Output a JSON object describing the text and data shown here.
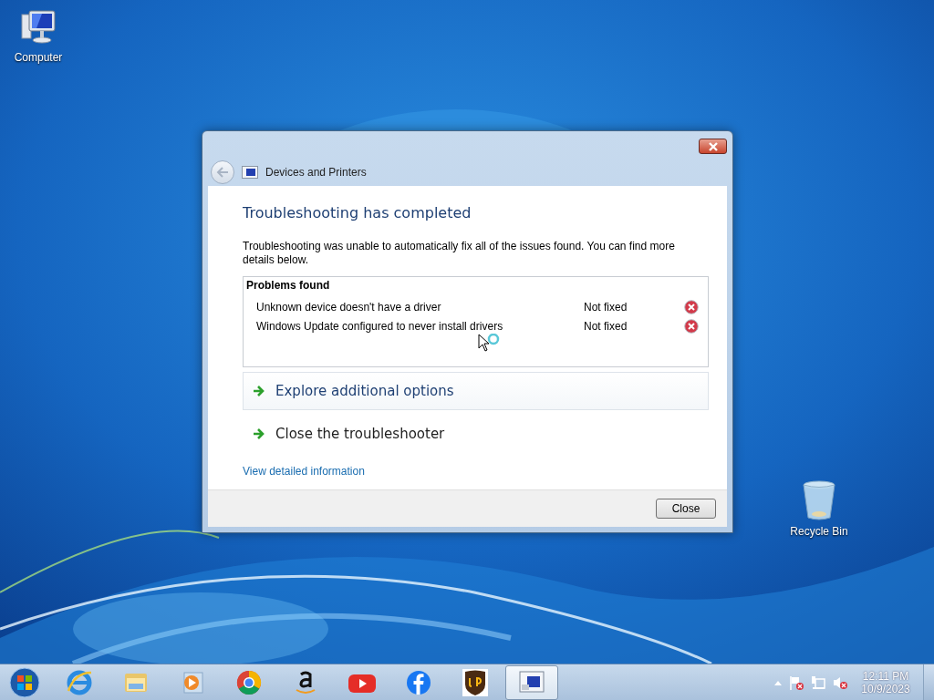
{
  "desktop_icons": [
    {
      "label": "Computer",
      "kind": "computer"
    },
    {
      "label": "Recycle Bin",
      "kind": "recycle"
    }
  ],
  "window": {
    "title": "Devices and Printers"
  },
  "heading": "Troubleshooting has completed",
  "message": "Troubleshooting was unable to automatically fix all of the issues found. You can find more details below.",
  "problems": {
    "title": "Problems found",
    "rows": [
      {
        "name": "Unknown device doesn't have a driver",
        "status": "Not fixed",
        "fixed": false
      },
      {
        "name": "Windows Update configured to never install drivers",
        "status": "Not fixed",
        "fixed": false
      }
    ]
  },
  "options": [
    {
      "label": "Explore additional options",
      "highlighted": true
    },
    {
      "label": "Close the troubleshooter",
      "highlighted": false
    }
  ],
  "details_link": "View detailed information",
  "buttons": [
    "Close"
  ],
  "taskbar": {
    "apps": [
      {
        "kind": "ie",
        "active": false
      },
      {
        "kind": "folder",
        "active": false
      },
      {
        "kind": "media",
        "active": false
      },
      {
        "kind": "chrome",
        "active": false
      },
      {
        "kind": "amazon",
        "active": false
      },
      {
        "kind": "youtube",
        "active": false
      },
      {
        "kind": "facebook",
        "active": false
      },
      {
        "kind": "ups",
        "active": false
      },
      {
        "kind": "devices",
        "active": true
      }
    ]
  },
  "tray": {
    "time": "12:11 PM",
    "date": "10/9/2023"
  }
}
